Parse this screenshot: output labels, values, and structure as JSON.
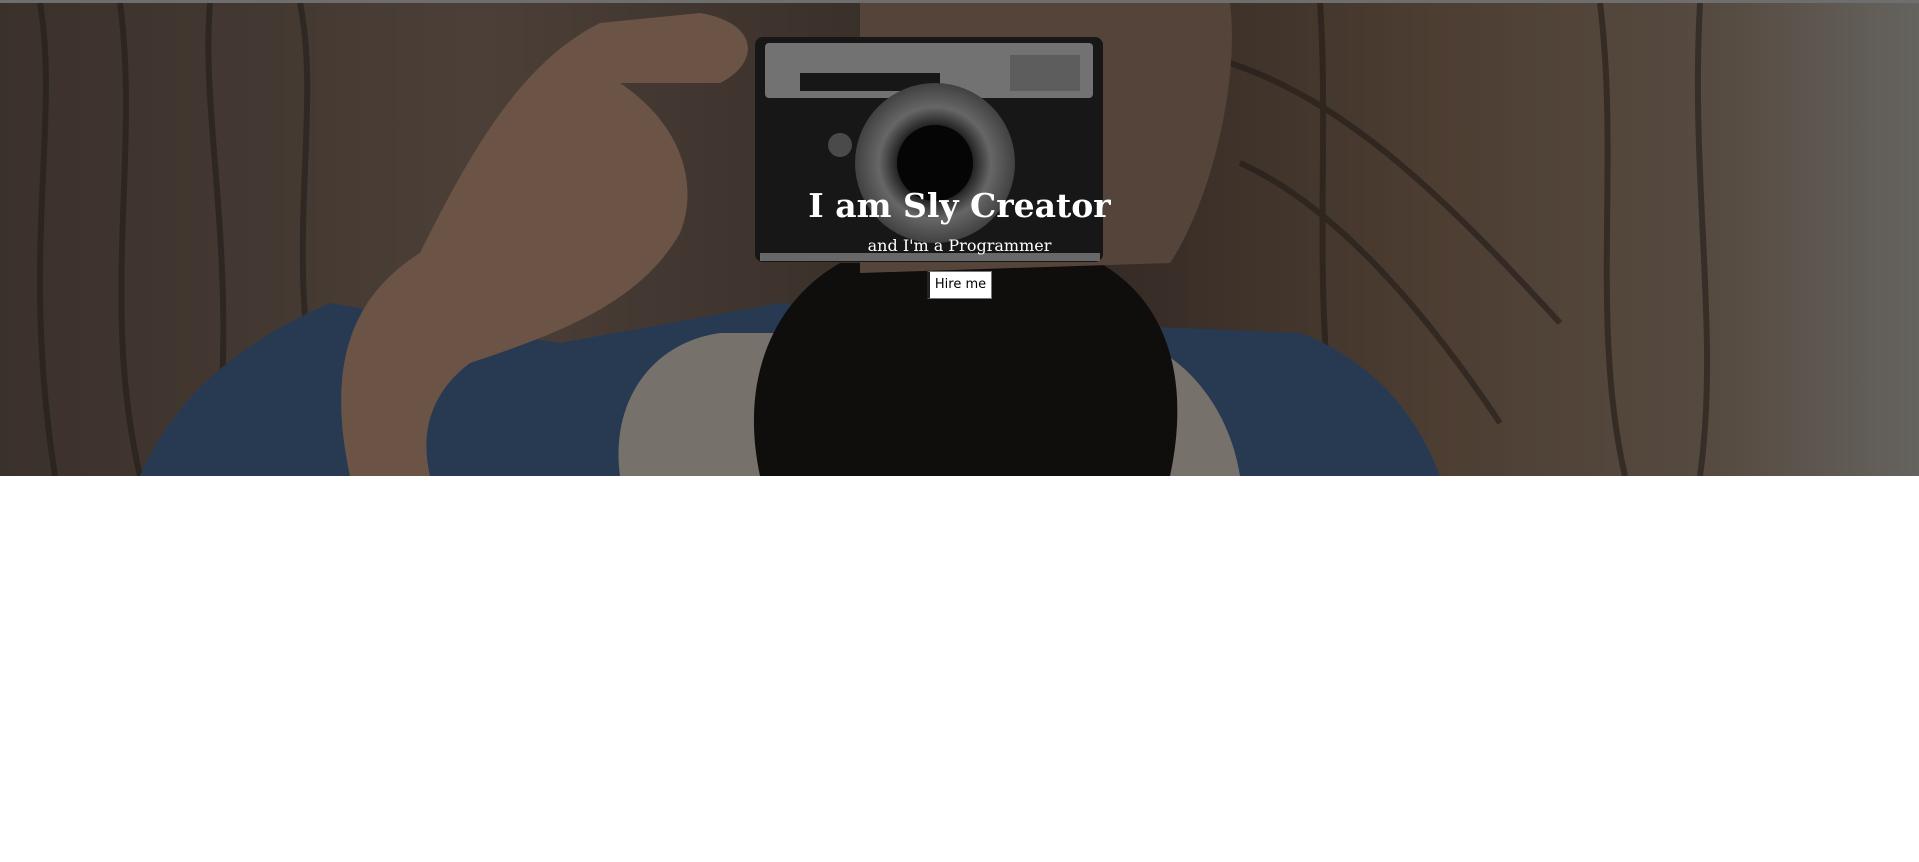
{
  "hero": {
    "title": "I am Sly Creator",
    "subtitle": "and I'm a Programmer",
    "button_label": "Hire me",
    "background_icon": "photographer-with-camera-image"
  },
  "colors": {
    "overlay": "#000000",
    "text": "#ffffff",
    "button_background": "#ffffff",
    "page_background": "#ffffff"
  }
}
